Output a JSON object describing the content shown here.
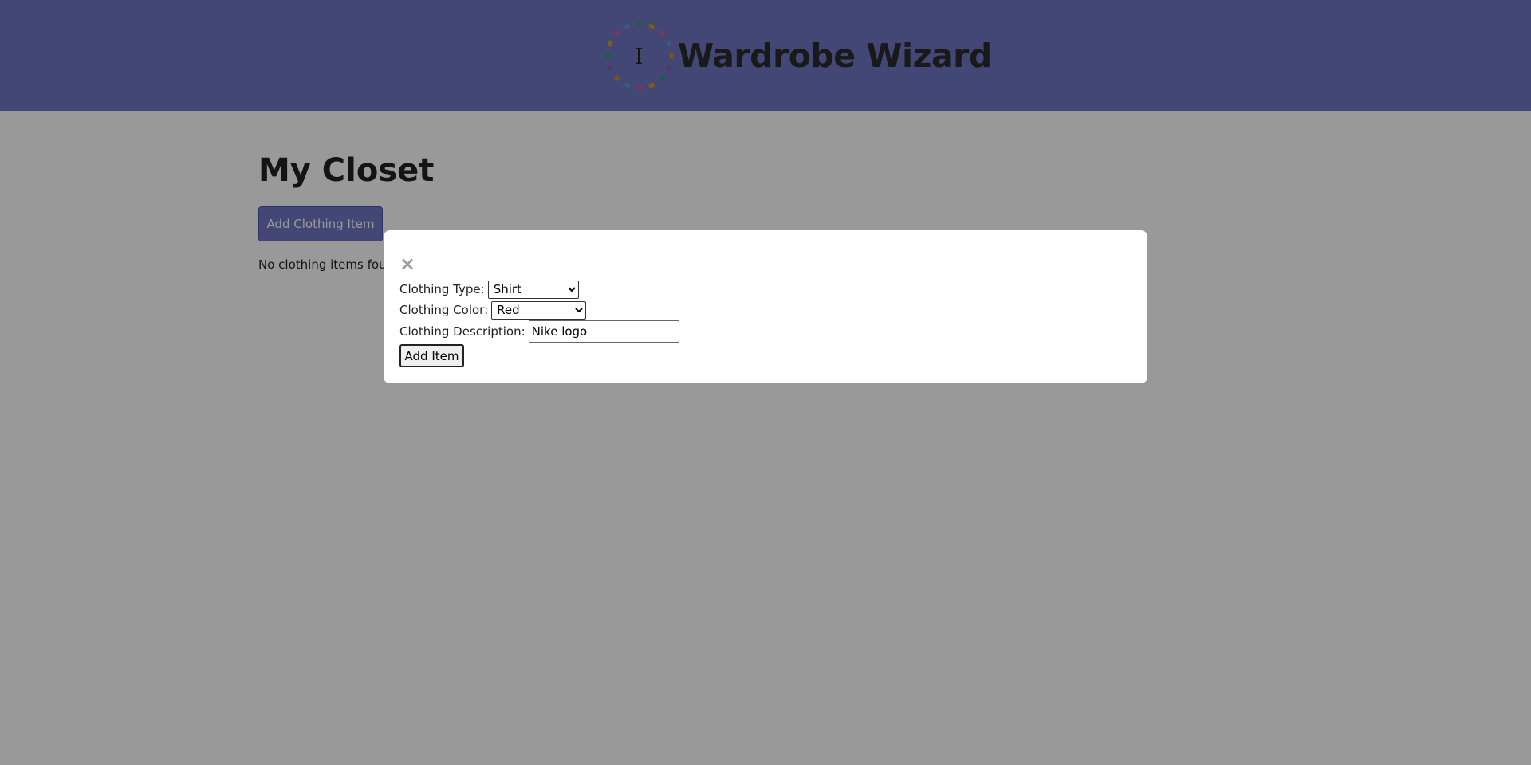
{
  "header": {
    "app_title": "Wardrobe Wizard",
    "logo_icon": "wardrobe-wizard-logo-icon",
    "colors": {
      "header_bg": "#7077c3"
    }
  },
  "main": {
    "page_title": "My Closet",
    "add_button_label": "Add Clothing Item",
    "empty_message": "No clothing items found."
  },
  "modal": {
    "close_label": "×",
    "close_icon": "close-icon",
    "type_label": "Clothing Type:",
    "type_value": "Shirt",
    "color_label": "Clothing Color:",
    "color_value": "Red",
    "description_label": "Clothing Description:",
    "description_value": "Nike logo",
    "submit_label": "Add Item"
  }
}
